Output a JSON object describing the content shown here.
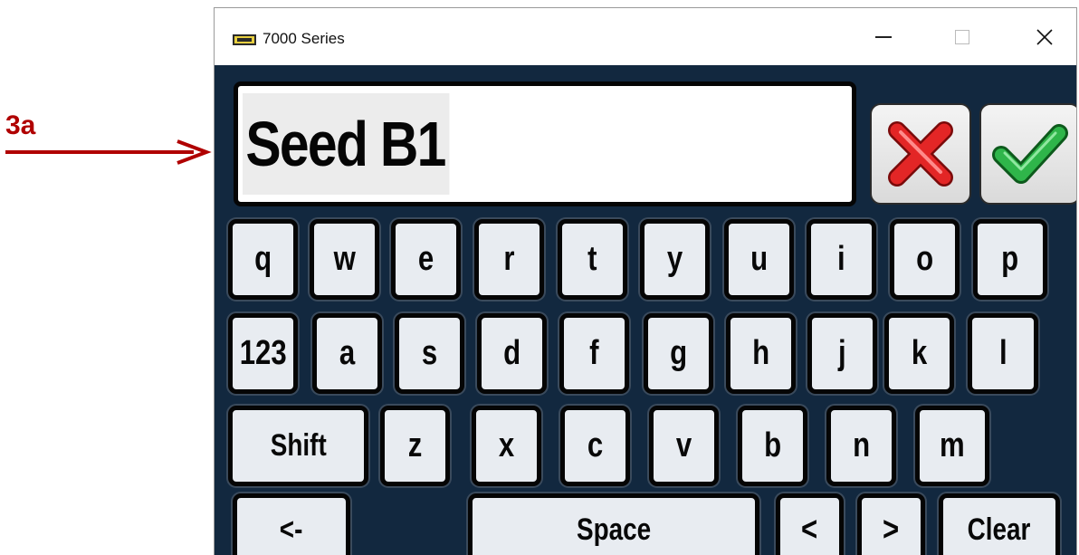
{
  "annotation": {
    "label": "3a",
    "color": "#b00000"
  },
  "window": {
    "title": "7000 Series",
    "icon": "app-icon"
  },
  "input": {
    "value": "Seed B1"
  },
  "actions": {
    "cancel_icon": "red-x-icon",
    "ok_icon": "green-check-icon"
  },
  "keyboard": {
    "row1": [
      "q",
      "w",
      "e",
      "r",
      "t",
      "y",
      "u",
      "i",
      "o",
      "p"
    ],
    "row2": [
      "123",
      "a",
      "s",
      "d",
      "f",
      "g",
      "h",
      "j",
      "k",
      "l"
    ],
    "row3": [
      "Shift",
      "z",
      "x",
      "c",
      "v",
      "b",
      "n",
      "m"
    ],
    "row4": [
      "<-",
      "Space",
      "<",
      ">",
      "Clear"
    ]
  },
  "colors": {
    "background": "#12283f",
    "key": "#e8ecf1",
    "key_border": "#050505"
  }
}
